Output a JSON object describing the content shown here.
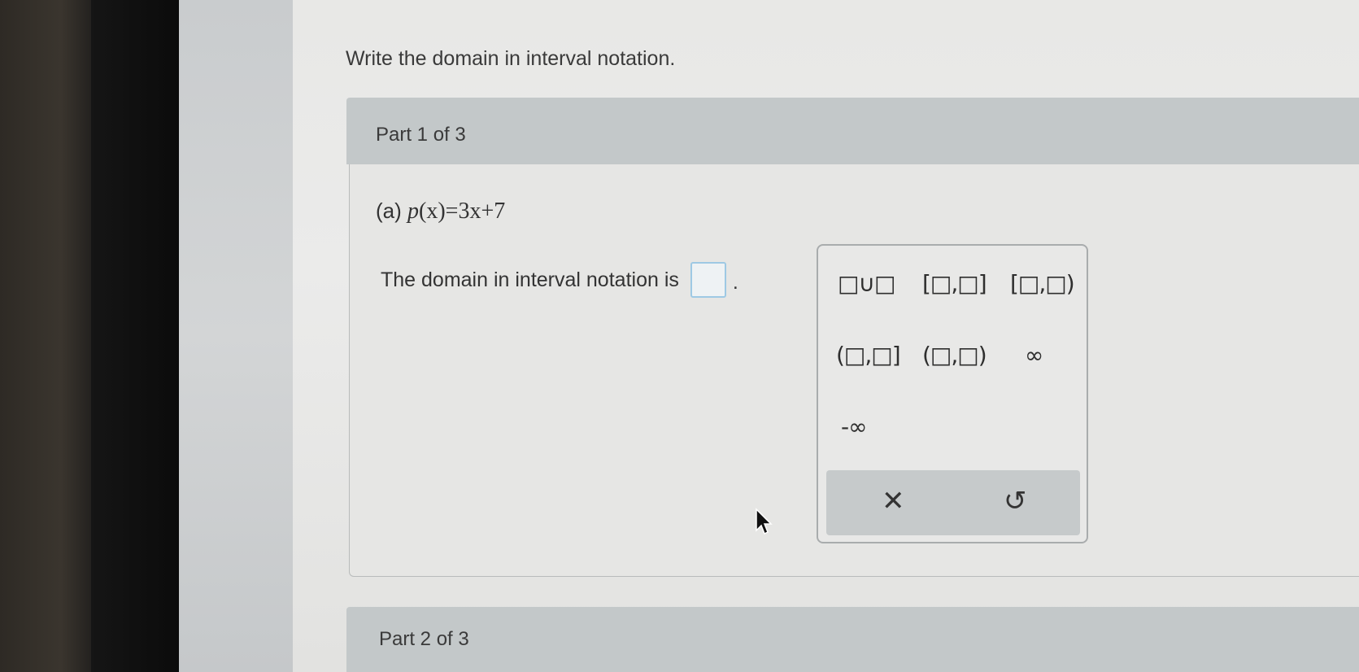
{
  "instruction": "Write the domain in interval notation.",
  "part1": {
    "label": "Part 1 of 3",
    "question_prefix": "(a)",
    "function_name": "p",
    "function_arg": "(x)",
    "function_rhs": "=3x+7",
    "answer_prompt": "The domain in interval notation is",
    "answer_value": "",
    "period": "."
  },
  "palette": {
    "union": "□∪□",
    "closed_interval": "[□,□]",
    "closed_open_interval": "[□,□)",
    "open_closed_interval": "(□,□]",
    "open_interval": "(□,□)",
    "infinity": "∞",
    "neg_infinity": "-∞",
    "clear": "✕",
    "undo": "↺"
  },
  "part2": {
    "label": "Part 2 of 3"
  },
  "colors": {
    "header_bg": "#c3c8c9",
    "answer_box_border": "#9ec9e4",
    "action_bar_bg": "#c6cacb"
  }
}
